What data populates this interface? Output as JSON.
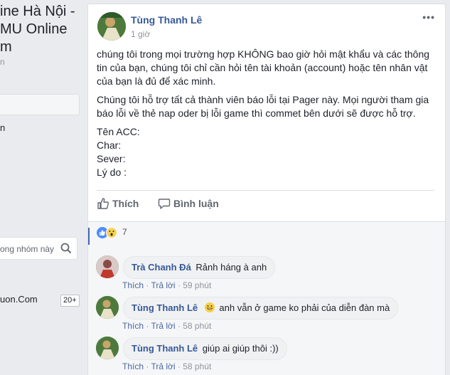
{
  "sidebar": {
    "group_title_lines": [
      "ine Hà Nội -",
      "MU Online",
      "m"
    ],
    "group_sub": "n",
    "letter": "n",
    "search_placeholder": "ong nhóm này",
    "link": "uon.Com",
    "badge": "20+"
  },
  "post": {
    "author": "Tùng Thanh Lê",
    "time": "1 giờ",
    "more": "•••",
    "paragraph1": "chúng tôi trong mọi trường hợp KHÔNG bao giờ hỏi mật khẩu và các thông tin của bạn, chúng tôi chỉ cần hỏi tên tài khoản (account) hoặc tên nhân vật của bạn là đủ để xác minh.",
    "paragraph2": "Chúng tôi hỗ trợ tất cả thành viên báo lỗi tại Pager này. Mọi người tham gia báo lỗi về thẻ nap oder bị lỗi game thì commet bên dưới sẽ được hỗ trợ.",
    "fields": [
      "Tên ACC:",
      "Char:",
      "Sever:",
      "Lý do :"
    ],
    "like_label": "Thích",
    "comment_label": "Bình luận",
    "reaction_count": "7"
  },
  "comments": [
    {
      "name": "Trà Chanh Đá",
      "text": "Rảnh háng à anh",
      "like": "Thích",
      "reply": "Trả lời",
      "time": "59 phút"
    },
    {
      "name": "Tùng Thanh Lê",
      "text": "anh vẫn ở game ko phải của diễn đàn mà",
      "like": "Thích",
      "reply": "Trả lời",
      "time": "58 phút"
    },
    {
      "name": "Tùng Thanh Lê",
      "text": "giúp ai giúp thôi :))",
      "like": "Thích",
      "reply": "Trả lời",
      "time": "58 phút"
    }
  ],
  "colors": {
    "link": "#365899",
    "accent": "#4267b2",
    "background": "#e9ebee"
  }
}
